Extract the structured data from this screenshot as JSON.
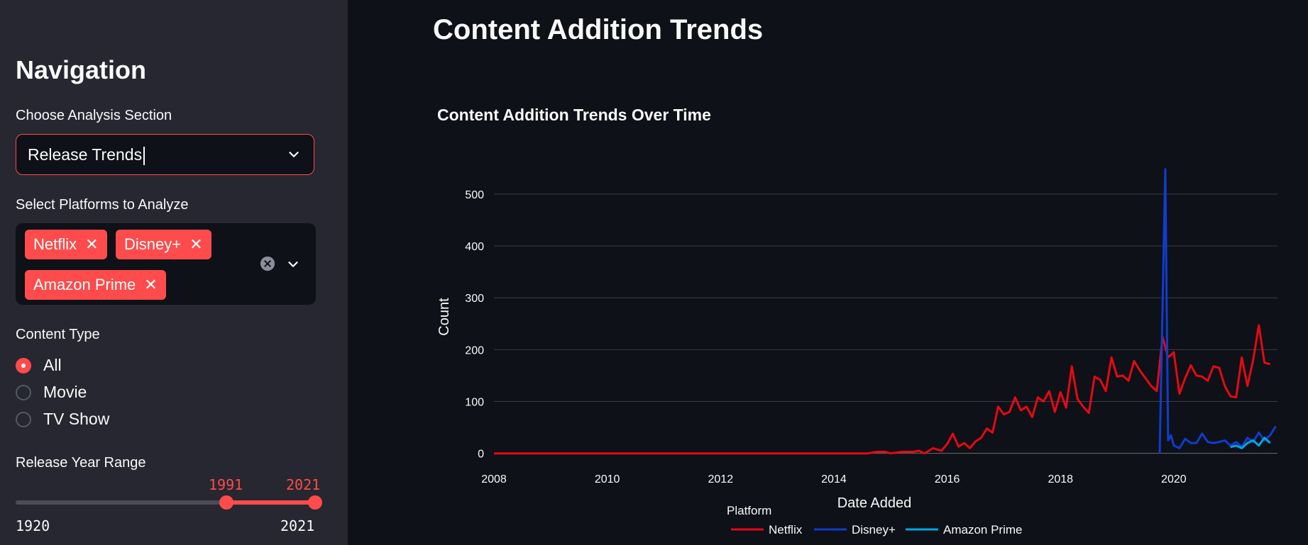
{
  "sidebar": {
    "title": "Navigation",
    "analysis_section": {
      "label": "Choose Analysis Section",
      "value": "Release Trends"
    },
    "platforms": {
      "label": "Select Platforms to Analyze",
      "selected": [
        "Netflix",
        "Disney+",
        "Amazon Prime"
      ]
    },
    "content_type": {
      "label": "Content Type",
      "options": [
        "All",
        "Movie",
        "TV Show"
      ],
      "selected": "All"
    },
    "release_year": {
      "label": "Release Year Range",
      "min": "1920",
      "max": "2021",
      "low": "1991",
      "high": "2021"
    }
  },
  "main": {
    "title": "Content Addition Trends"
  },
  "colors": {
    "accent": "#ff4b4b",
    "netflix": "#e50914",
    "disney": "#113ccf",
    "amazon": "#00a8e1"
  },
  "chart_data": {
    "type": "line",
    "title": "Content Addition Trends Over Time",
    "xlabel": "Date Added",
    "ylabel": "Count",
    "xlim": [
      2008,
      2021.83
    ],
    "ylim": [
      -10,
      560
    ],
    "xticks": [
      "2008",
      "2010",
      "2012",
      "2014",
      "2016",
      "2018",
      "2020"
    ],
    "yticks": [
      "0",
      "100",
      "200",
      "300",
      "400",
      "500"
    ],
    "legend_title": "Platform",
    "legend_position": "bottom",
    "grid": true,
    "series": [
      {
        "name": "Netflix",
        "x": [
          2008,
          2014.6,
          2014.75,
          2014.9,
          2015.0,
          2015.2,
          2015.4,
          2015.5,
          2015.6,
          2015.75,
          2015.9,
          2016.0,
          2016.1,
          2016.2,
          2016.3,
          2016.4,
          2016.5,
          2016.6,
          2016.7,
          2016.8,
          2016.9,
          2017.0,
          2017.1,
          2017.2,
          2017.3,
          2017.4,
          2017.5,
          2017.6,
          2017.7,
          2017.8,
          2017.9,
          2018.0,
          2018.1,
          2018.2,
          2018.3,
          2018.4,
          2018.5,
          2018.6,
          2018.7,
          2018.8,
          2018.9,
          2019.0,
          2019.1,
          2019.2,
          2019.3,
          2019.4,
          2019.5,
          2019.6,
          2019.7,
          2019.8,
          2019.9,
          2020.0,
          2020.1,
          2020.2,
          2020.3,
          2020.4,
          2020.5,
          2020.6,
          2020.7,
          2020.8,
          2020.9,
          2021.0,
          2021.1,
          2021.2,
          2021.3,
          2021.4,
          2021.5,
          2021.6,
          2021.7
        ],
        "values": [
          0,
          0,
          3,
          3,
          0,
          3,
          3,
          5,
          0,
          10,
          5,
          18,
          38,
          13,
          20,
          10,
          23,
          30,
          48,
          40,
          90,
          75,
          80,
          108,
          83,
          90,
          70,
          108,
          100,
          120,
          80,
          118,
          88,
          168,
          105,
          90,
          78,
          148,
          142,
          120,
          185,
          148,
          150,
          140,
          178,
          160,
          145,
          130,
          120,
          225,
          185,
          195,
          115,
          145,
          170,
          150,
          148,
          140,
          168,
          165,
          130,
          110,
          108,
          185,
          130,
          180,
          247,
          175,
          172
        ]
      },
      {
        "name": "Disney+",
        "x": [
          2019.75,
          2019.85,
          2019.9,
          2019.95,
          2020.0,
          2020.1,
          2020.2,
          2020.3,
          2020.4,
          2020.5,
          2020.6,
          2020.7,
          2020.8,
          2020.9,
          2021.0,
          2021.1,
          2021.2,
          2021.3,
          2021.4,
          2021.5,
          2021.6,
          2021.7,
          2021.8
        ],
        "values": [
          0,
          548,
          25,
          35,
          15,
          10,
          28,
          20,
          20,
          38,
          22,
          20,
          22,
          25,
          15,
          22,
          13,
          30,
          22,
          40,
          25,
          35,
          52
        ]
      },
      {
        "name": "Amazon Prime",
        "x": [
          2021.0,
          2021.1,
          2021.2,
          2021.3,
          2021.4,
          2021.5,
          2021.6,
          2021.7
        ],
        "values": [
          12,
          15,
          10,
          20,
          25,
          15,
          30,
          20
        ]
      }
    ]
  }
}
